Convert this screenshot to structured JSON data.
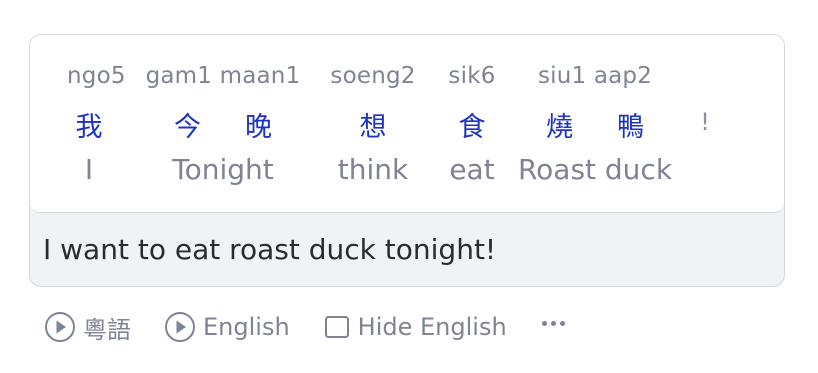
{
  "words": [
    {
      "jyutping": "ngo5",
      "hanzi": [
        "我"
      ],
      "english": "I"
    },
    {
      "jyutping": "gam1 maan1",
      "hanzi": [
        "今",
        "晚"
      ],
      "english": "Tonight"
    },
    {
      "jyutping": "soeng2",
      "hanzi": [
        "想"
      ],
      "english": "think"
    },
    {
      "jyutping": "sik6",
      "hanzi": [
        "食"
      ],
      "english": "eat"
    },
    {
      "jyutping": "siu1 aap2",
      "hanzi": [
        "燒",
        "鴨"
      ],
      "english": "Roast duck"
    }
  ],
  "punctuation": "!",
  "translation": "I want to eat roast duck tonight!",
  "toolbar": {
    "play_cantonese_label": "粵語",
    "play_english_label": "English",
    "hide_english_label": "Hide English"
  },
  "colors": {
    "hanzi": "#1d33c4",
    "muted": "#7e8494",
    "text": "#2a2c33",
    "border": "#d6d9de"
  }
}
